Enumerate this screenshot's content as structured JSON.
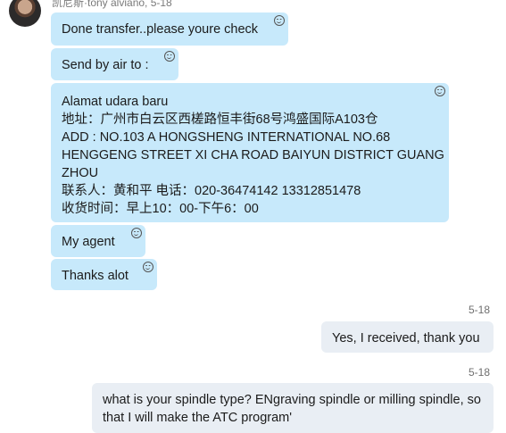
{
  "header": {
    "sender": "凯尼斯·tony alviano, 5-18"
  },
  "messages_in": [
    {
      "text": "Done transfer..please youre check"
    },
    {
      "text": "Send by air to :"
    },
    {
      "lines": [
        "Alamat udara baru",
        "地址：广州市白云区西槎路恒丰街68号鸿盛国际A103仓",
        "ADD : NO.103 A HONGSHENG INTERNATIONAL NO.68",
        "HENGGENG STREET XI CHA ROAD BAIYUN DISTRICT GUANG",
        "ZHOU",
        "联系人：黄和平 电话：020-36474142  13312851478",
        "收货时间：早上10：00-下午6：00"
      ]
    },
    {
      "text": "My agent"
    },
    {
      "text": "Thanks alot"
    }
  ],
  "messages_out": [
    {
      "timestamp": "5-18",
      "text": "Yes,  I received, thank you"
    },
    {
      "timestamp": "5-18",
      "text": "what is your spindle type?   ENgraving spindle or milling spindle, so that I will make the ATC program'"
    }
  ],
  "icons": {
    "reaction": "smiley-icon",
    "avatar": "user-avatar"
  },
  "colors": {
    "incoming_bubble": "#c7e9fb",
    "outgoing_bubble": "#e9eef4"
  }
}
